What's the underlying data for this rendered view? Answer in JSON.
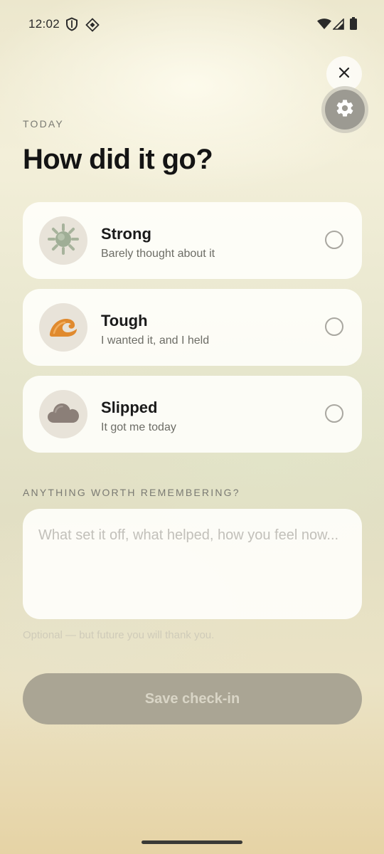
{
  "status_bar": {
    "time": "12:02"
  },
  "header": {
    "eyebrow": "TODAY",
    "title": "How did it go?"
  },
  "options": [
    {
      "title": "Strong",
      "subtitle": "Barely thought about it",
      "icon": "sun-icon",
      "selected": false
    },
    {
      "title": "Tough",
      "subtitle": "I wanted it, and I held",
      "icon": "wave-icon",
      "selected": false
    },
    {
      "title": "Slipped",
      "subtitle": "It got me today",
      "icon": "cloud-icon",
      "selected": false
    }
  ],
  "notes": {
    "label": "ANYTHING WORTH REMEMBERING?",
    "placeholder": "What set it off, what helped, how you feel now...",
    "hint": "Optional — but future you will thank you."
  },
  "save": {
    "label": "Save check-in",
    "enabled": false
  },
  "colors": {
    "strong_icon": "#9fae96",
    "tough_icon": "#e08a2e",
    "slipped_icon": "#8b7f78",
    "save_button": "#aaa594"
  }
}
